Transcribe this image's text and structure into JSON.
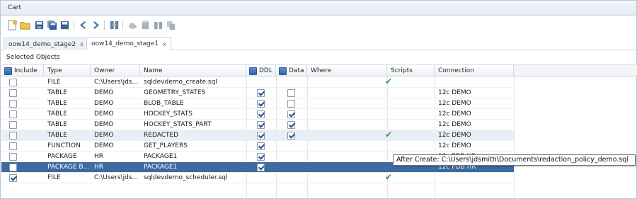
{
  "panel": {
    "title": "Cart"
  },
  "toolbar": {
    "icons": [
      "new-cart-icon",
      "open-folder-icon",
      "save-icon",
      "save-all-icon",
      "deploy-icon",
      "back-arrow-icon",
      "forward-arrow-icon",
      "binoculars-icon",
      "cloud-icon",
      "database-icon",
      "binocular-pair-icon",
      "copy-icon"
    ]
  },
  "tabs": [
    {
      "label": "oow14_demo_stage2",
      "close": "x",
      "active": false
    },
    {
      "label": "oow14_demo_stage1",
      "close": "x",
      "active": true
    }
  ],
  "section": {
    "label": "Selected Objects"
  },
  "columns": {
    "include": "Include",
    "type": "Type",
    "owner": "Owner",
    "name": "Name",
    "ddl": "DDL",
    "data": "Data",
    "where": "Where",
    "scripts": "Scripts",
    "connection": "Connection"
  },
  "rows": [
    {
      "include": false,
      "type": "FILE",
      "owner": "C:\\Users\\jds...",
      "name": "sqldevdemo_create.sql",
      "ddl": null,
      "data": null,
      "script": true,
      "connection": ""
    },
    {
      "include": false,
      "type": "TABLE",
      "owner": "DEMO",
      "name": "GEOMETRY_STATES",
      "ddl": true,
      "data": false,
      "script": false,
      "connection": "12c DEMO"
    },
    {
      "include": false,
      "type": "TABLE",
      "owner": "DEMO",
      "name": "BLOB_TABLE",
      "ddl": true,
      "data": false,
      "script": false,
      "connection": "12c DEMO"
    },
    {
      "include": false,
      "type": "TABLE",
      "owner": "DEMO",
      "name": "HOCKEY_STATS",
      "ddl": true,
      "data": true,
      "script": false,
      "connection": "12c DEMO"
    },
    {
      "include": false,
      "type": "TABLE",
      "owner": "DEMO",
      "name": "HOCKEY_STATS_PART",
      "ddl": true,
      "data": true,
      "script": false,
      "connection": "12c DEMO"
    },
    {
      "include": false,
      "type": "TABLE",
      "owner": "DEMO",
      "name": "REDACTED",
      "ddl": true,
      "data": true,
      "script": true,
      "connection": "12c DEMO"
    },
    {
      "include": false,
      "type": "FUNCTION",
      "owner": "DEMO",
      "name": "GET_PLAYERS",
      "ddl": true,
      "data": null,
      "script": false,
      "connection": "12c DEMO"
    },
    {
      "include": false,
      "type": "PACKAGE",
      "owner": "HR",
      "name": "PACKAGE1",
      "ddl": true,
      "data": null,
      "script": false,
      "connection": "12c PDB HR"
    },
    {
      "include": false,
      "type": "PACKAGE B...",
      "owner": "HR",
      "name": "PACKAGE1",
      "ddl": true,
      "data": null,
      "script": false,
      "connection": "12c PDB HR"
    },
    {
      "include": true,
      "type": "FILE",
      "owner": "C:\\Users\\jds...",
      "name": "sqldevdemo_scheduler.sql",
      "ddl": null,
      "data": null,
      "script": true,
      "connection": ""
    }
  ],
  "tooltip": {
    "text": "After Create: C:\\Users\\jdsmith\\Documents\\redaction_policy_demo.sql"
  },
  "colors": {
    "selection": "#3d6aa0",
    "hover_row": "#e9eef7",
    "check_green": "#2f9a2f"
  }
}
